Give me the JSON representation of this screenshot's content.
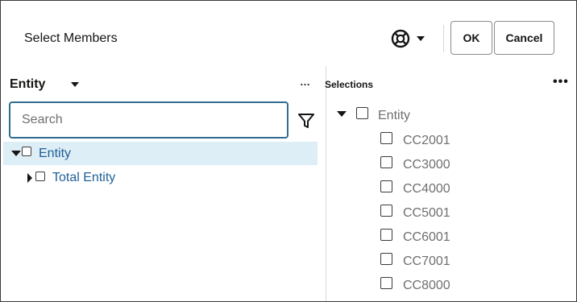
{
  "dialog": {
    "title": "Select Members",
    "ok_label": "OK",
    "cancel_label": "Cancel",
    "help_icon": "lifebuoy-icon"
  },
  "left_panel": {
    "dimension_label": "Entity",
    "more_label": "…",
    "search": {
      "placeholder": "Search",
      "value": ""
    },
    "filter_icon": "filter-icon",
    "tree": [
      {
        "label": "Entity",
        "expanded": true
      },
      {
        "label": "Total Entity",
        "expanded": false
      }
    ]
  },
  "right_panel": {
    "title": "Selections",
    "more_label": "•••",
    "root": {
      "label": "Entity"
    },
    "items": [
      "CC2001",
      "CC3000",
      "CC4000",
      "CC5001",
      "CC6001",
      "CC7001",
      "CC8000"
    ]
  },
  "colors": {
    "link_blue": "#1f5f96",
    "selected_row_bg": "#deeef7",
    "search_border": "#2f6d8f",
    "muted_text": "#6f6f6f"
  }
}
